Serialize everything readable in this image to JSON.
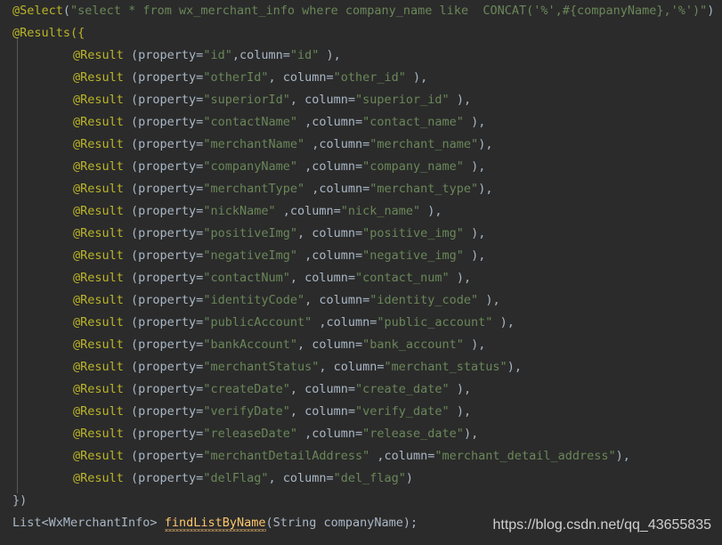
{
  "editor": {
    "theme_name": "darcula",
    "background_color": "#2b2b2b",
    "default_text_color": "#a9b7c6",
    "annotation_color": "#bbb529",
    "string_color": "#6a8759",
    "method_color": "#ffc66d",
    "indent_guide_color": "#585858",
    "language": "java"
  },
  "code": {
    "select_annotation": {
      "annotation": "@Select",
      "open_paren": "(",
      "sql_string": "\"select * from wx_merchant_info where company_name like  CONCAT('%',#{companyName},'%')\"",
      "close_paren": ")"
    },
    "results_open": "@Results({",
    "results_close": "})",
    "result_entries": [
      {
        "annotation": "@Result",
        "prefix": " (property=",
        "property": "\"id\"",
        "separator": ",column=",
        "column": "\"id\"",
        "suffix": " ),"
      },
      {
        "annotation": "@Result",
        "prefix": " (property=",
        "property": "\"otherId\"",
        "separator": ", column=",
        "column": "\"other_id\"",
        "suffix": " ),"
      },
      {
        "annotation": "@Result",
        "prefix": " (property=",
        "property": "\"superiorId\"",
        "separator": ", column=",
        "column": "\"superior_id\"",
        "suffix": " ),"
      },
      {
        "annotation": "@Result",
        "prefix": " (property=",
        "property": "\"contactName\"",
        "separator": " ,column=",
        "column": "\"contact_name\"",
        "suffix": " ),"
      },
      {
        "annotation": "@Result",
        "prefix": " (property=",
        "property": "\"merchantName\"",
        "separator": " ,column=",
        "column": "\"merchant_name\"",
        "suffix": "),"
      },
      {
        "annotation": "@Result",
        "prefix": " (property=",
        "property": "\"companyName\"",
        "separator": " ,column=",
        "column": "\"company_name\"",
        "suffix": " ),"
      },
      {
        "annotation": "@Result",
        "prefix": " (property=",
        "property": "\"merchantType\"",
        "separator": " ,column=",
        "column": "\"merchant_type\"",
        "suffix": "),"
      },
      {
        "annotation": "@Result",
        "prefix": " (property=",
        "property": "\"nickName\"",
        "separator": " ,column=",
        "column": "\"nick_name\"",
        "suffix": " ),"
      },
      {
        "annotation": "@Result",
        "prefix": " (property=",
        "property": "\"positiveImg\"",
        "separator": ", column=",
        "column": "\"positive_img\"",
        "suffix": " ),"
      },
      {
        "annotation": "@Result",
        "prefix": " (property=",
        "property": "\"negativeImg\"",
        "separator": " ,column=",
        "column": "\"negative_img\"",
        "suffix": " ),"
      },
      {
        "annotation": "@Result",
        "prefix": " (property=",
        "property": "\"contactNum\"",
        "separator": ", column=",
        "column": "\"contact_num\"",
        "suffix": " ),"
      },
      {
        "annotation": "@Result",
        "prefix": " (property=",
        "property": "\"identityCode\"",
        "separator": ", column=",
        "column": "\"identity_code\"",
        "suffix": " ),"
      },
      {
        "annotation": "@Result",
        "prefix": " (property=",
        "property": "\"publicAccount\"",
        "separator": " ,column=",
        "column": "\"public_account\"",
        "suffix": " ),"
      },
      {
        "annotation": "@Result",
        "prefix": " (property=",
        "property": "\"bankAccount\"",
        "separator": ", column=",
        "column": "\"bank_account\"",
        "suffix": " ),"
      },
      {
        "annotation": "@Result",
        "prefix": " (property=",
        "property": "\"merchantStatus\"",
        "separator": ", column=",
        "column": "\"merchant_status\"",
        "suffix": "),"
      },
      {
        "annotation": "@Result",
        "prefix": " (property=",
        "property": "\"createDate\"",
        "separator": ", column=",
        "column": "\"create_date\"",
        "suffix": " ),"
      },
      {
        "annotation": "@Result",
        "prefix": " (property=",
        "property": "\"verifyDate\"",
        "separator": ", column=",
        "column": "\"verify_date\"",
        "suffix": " ),"
      },
      {
        "annotation": "@Result",
        "prefix": " (property=",
        "property": "\"releaseDate\"",
        "separator": " ,column=",
        "column": "\"release_date\"",
        "suffix": "),"
      },
      {
        "annotation": "@Result",
        "prefix": " (property=",
        "property": "\"merchantDetailAddress\"",
        "separator": " ,column=",
        "column": "\"merchant_detail_address\"",
        "suffix": "),"
      },
      {
        "annotation": "@Result",
        "prefix": " (property=",
        "property": "\"delFlag\"",
        "separator": ", column=",
        "column": "\"del_flag\"",
        "suffix": ")"
      }
    ],
    "method_signature": {
      "return_type": "List<WxMerchantInfo>",
      "space": " ",
      "method_name": "findListByName",
      "params": "(String companyName);"
    }
  },
  "watermark": {
    "text": "https://blog.csdn.net/qq_43655835"
  }
}
